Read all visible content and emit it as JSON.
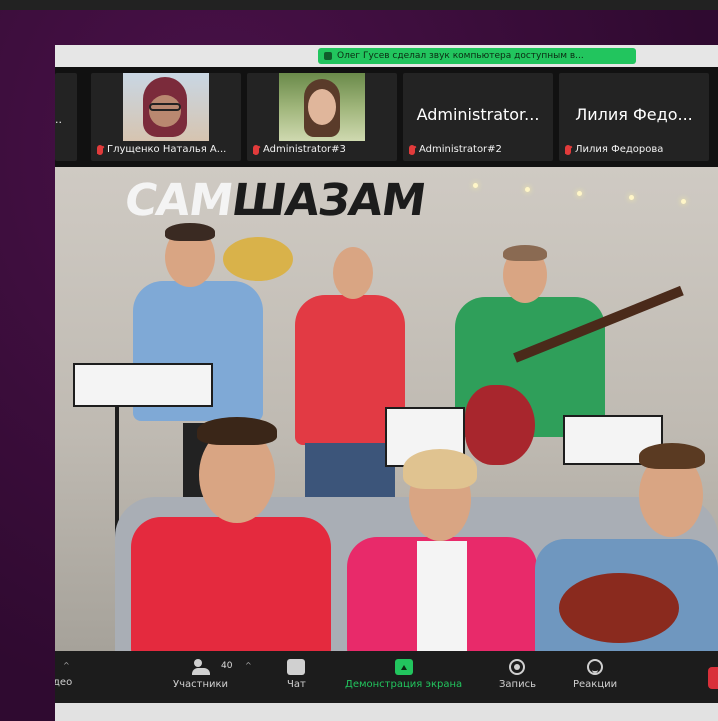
{
  "banner": {
    "text": "Олег Гусев сделал звук компьютера доступным в..."
  },
  "participants": [
    {
      "name": "Глущенко Наталья А..."
    },
    {
      "name": "Administrator#3"
    },
    {
      "display": "Administrator...",
      "name": "Administrator#2"
    },
    {
      "display": "Лилия Федо...",
      "name": "Лилия Федорова"
    }
  ],
  "video": {
    "wall_logo_dark": "САМ",
    "wall_logo_light": "ШАЗАМ"
  },
  "toolbar": {
    "participants_count": "40",
    "items": [
      {
        "label": "део"
      },
      {
        "label": "Участники"
      },
      {
        "label": "Чат"
      },
      {
        "label": "Демонстрация экрана"
      },
      {
        "label": "Запись"
      },
      {
        "label": "Реакции"
      }
    ]
  },
  "colors": {
    "accent": "#22c55e",
    "mute": "#e23b3b",
    "end": "#d9303a"
  }
}
